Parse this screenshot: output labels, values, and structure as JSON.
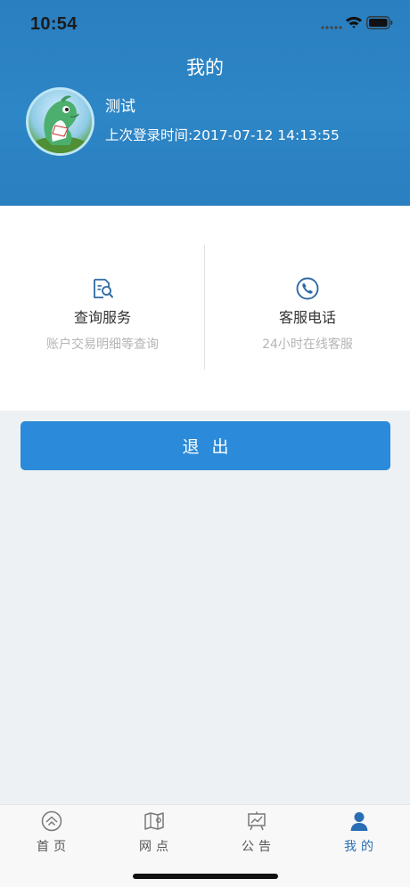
{
  "status_bar": {
    "time": "10:54"
  },
  "header": {
    "title": "我的",
    "user_name": "测试",
    "last_login": "上次登录时间:2017-07-12 14:13:55"
  },
  "services": [
    {
      "label": "查询服务",
      "sub": "账户交易明细等查询",
      "icon": "search-document-icon"
    },
    {
      "label": "客服电话",
      "sub": "24小时在线客服",
      "icon": "phone-icon"
    }
  ],
  "logout_label": "退出",
  "tabs": [
    {
      "label": "首页",
      "icon": "home-icon",
      "active": false
    },
    {
      "label": "网点",
      "icon": "map-icon",
      "active": false
    },
    {
      "label": "公告",
      "icon": "announcement-icon",
      "active": false
    },
    {
      "label": "我的",
      "icon": "user-icon",
      "active": true
    }
  ],
  "colors": {
    "header_blue": "#2d86c6",
    "button_blue": "#2b8ad9",
    "active_tab": "#2a6fb5",
    "background": "#eef1f4"
  }
}
